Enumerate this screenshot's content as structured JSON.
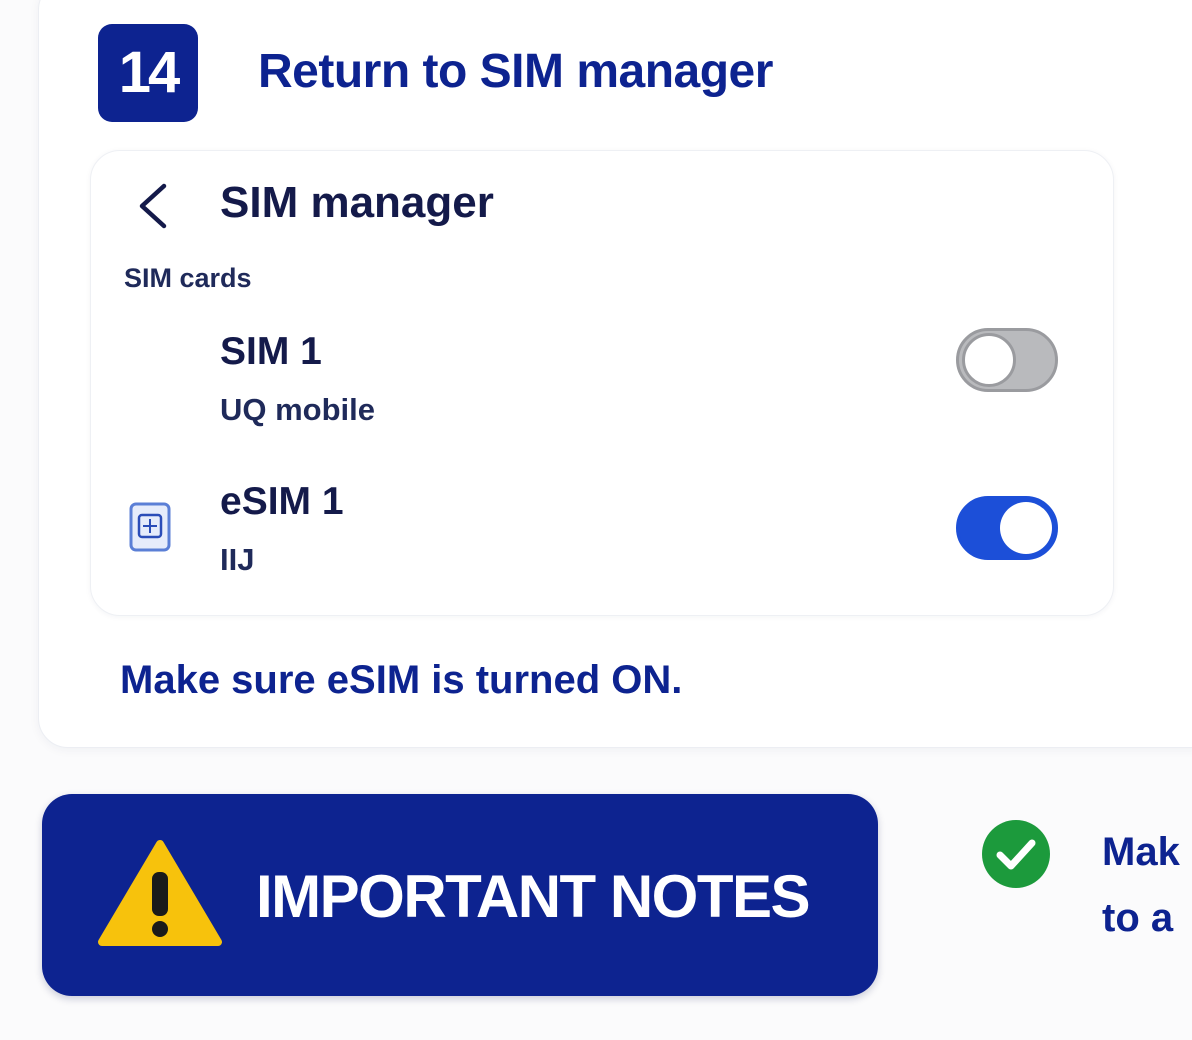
{
  "step": {
    "number": "14",
    "title": "Return to SIM manager"
  },
  "screen": {
    "title": "SIM manager",
    "section_label": "SIM cards",
    "sims": [
      {
        "name": "SIM 1",
        "carrier": "UQ mobile",
        "enabled": false,
        "icon": "none"
      },
      {
        "name": "eSIM 1",
        "carrier": "IIJ",
        "enabled": true,
        "icon": "esim-chip-icon"
      }
    ]
  },
  "instruction": "Make sure eSIM is turned ON.",
  "notes_button": {
    "label": "IMPORTANT NOTES",
    "icon": "warning-icon"
  },
  "side_note": {
    "icon": "check-circle-icon",
    "line1": "Mak",
    "line2": "to a"
  },
  "colors": {
    "brand_navy": "#0d2390",
    "toggle_on": "#1c4fd8",
    "toggle_off": "#b9babd",
    "warning_yellow": "#f7c20c",
    "check_green": "#1c9a3c"
  }
}
